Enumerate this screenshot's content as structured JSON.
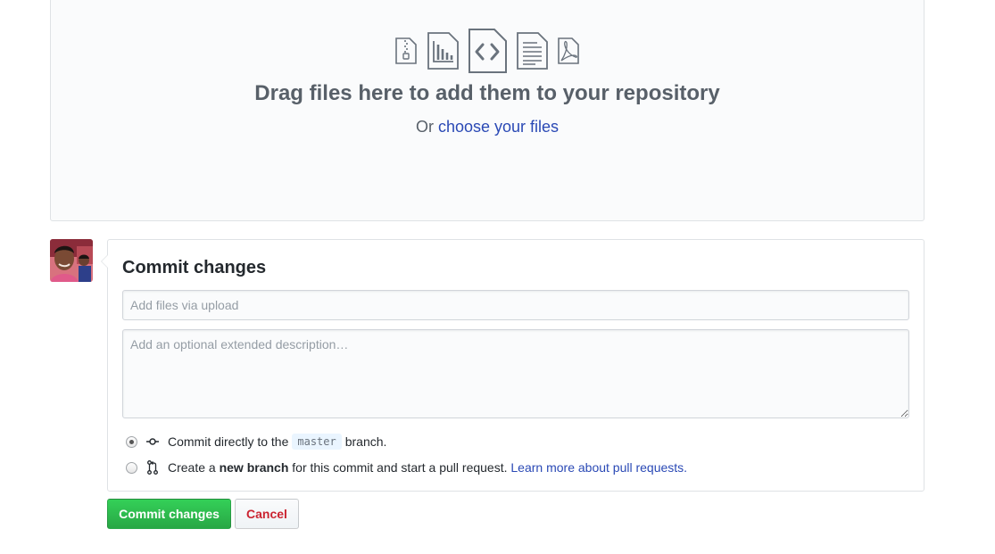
{
  "dropzone": {
    "icons": [
      "zip-file-icon",
      "chart-file-icon",
      "code-file-icon",
      "text-file-icon",
      "pdf-file-icon"
    ],
    "title": "Drag files here to add them to your repository",
    "sub_prefix": "Or",
    "sub_link": "choose your files"
  },
  "commit": {
    "title": "Commit changes",
    "summary_placeholder": "Add files via upload",
    "summary_value": "",
    "description_placeholder": "Add an optional extended description…",
    "description_value": "",
    "option_direct": {
      "prefix": "Commit directly to the",
      "branch": "master",
      "suffix": "branch.",
      "selected": true
    },
    "option_new": {
      "prefix": "Create a",
      "bold": "new branch",
      "suffix": "for this commit and start a pull request.",
      "link": "Learn more about pull requests.",
      "selected": false
    }
  },
  "buttons": {
    "commit_label": "Commit changes",
    "cancel_label": "Cancel"
  },
  "colors": {
    "link": "#2a49b5",
    "commit_button": "#28a745",
    "cancel_text": "#cb2431"
  }
}
